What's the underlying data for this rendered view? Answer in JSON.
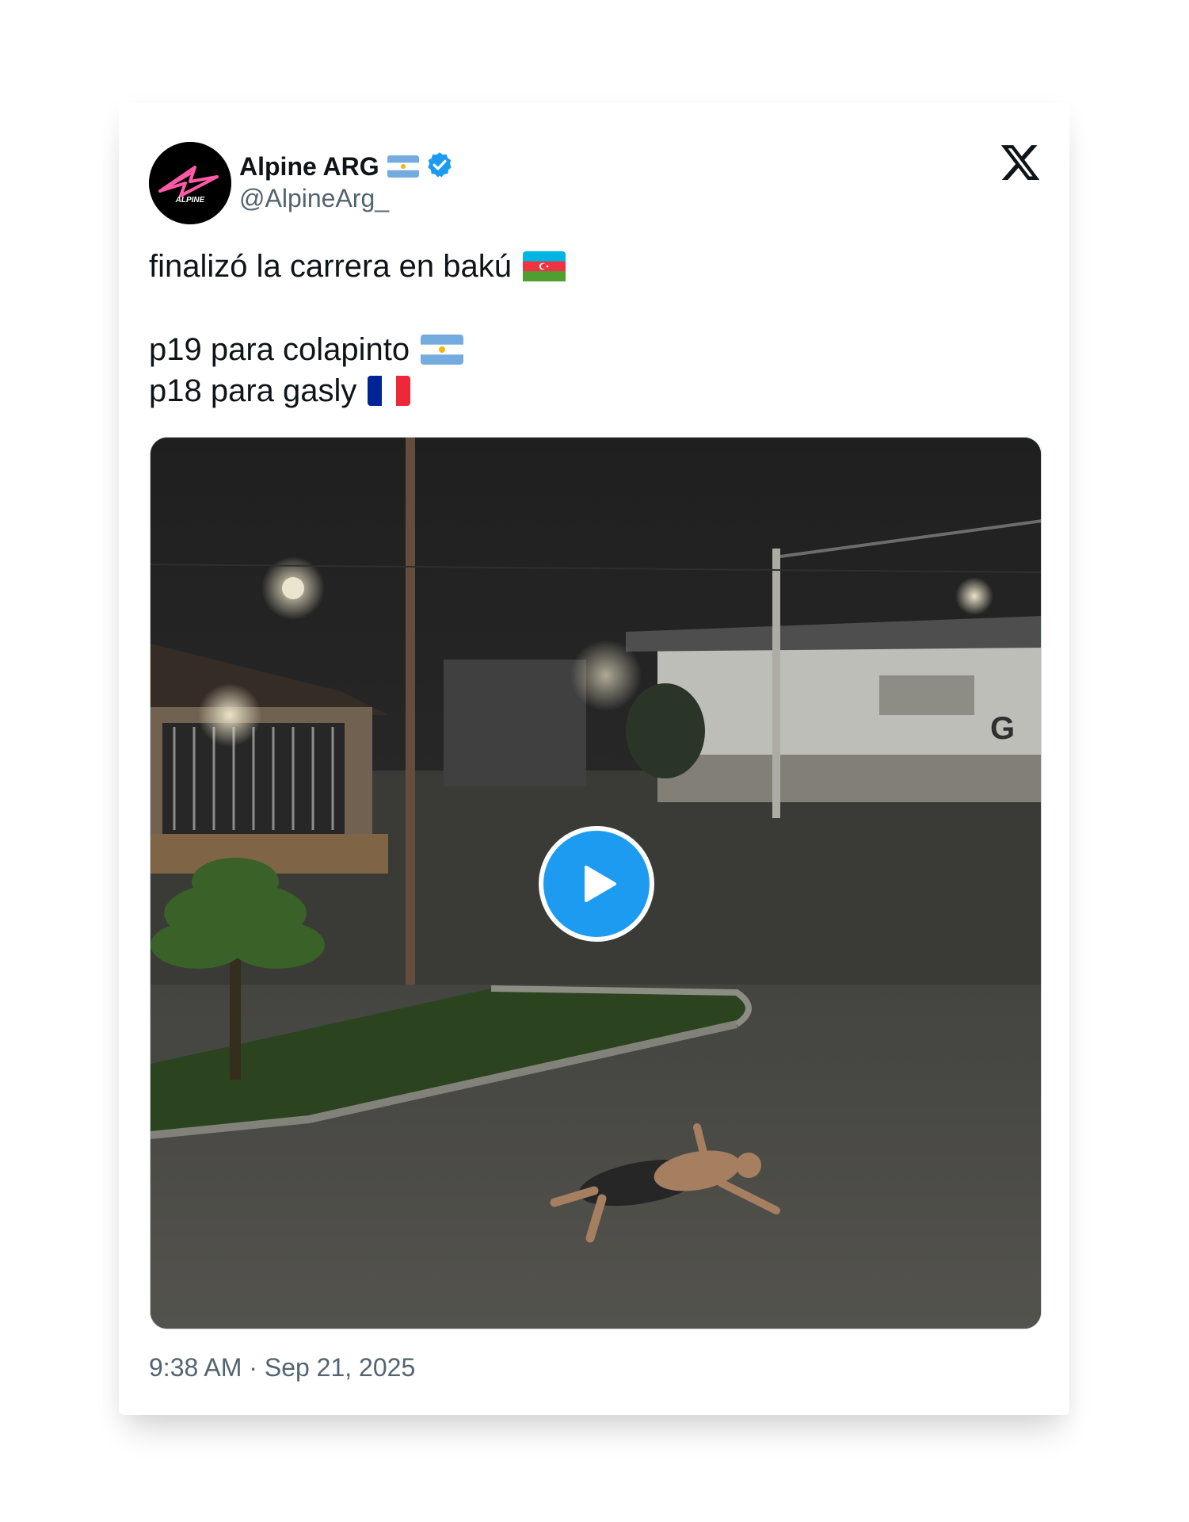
{
  "author": {
    "display_name": "Alpine ARG",
    "handle": "@AlpineArg_",
    "verified": true,
    "avatar_icon": "alpine-logo-icon",
    "avatar_logo_text": "ALPINE"
  },
  "platform": {
    "logo_icon": "x-logo-icon"
  },
  "tweet": {
    "line1": "finalizó la carrera en bakú",
    "line2": "p19 para colapinto",
    "line3": "p18 para gasly"
  },
  "media": {
    "type": "video",
    "play_icon": "play-icon",
    "sign_text": "G"
  },
  "timestamp": "9:38 AM · Sep 21, 2025",
  "colors": {
    "accent": "#1d9bf0",
    "text": "#0f1419",
    "secondary_text": "#536471",
    "alpine_pink": "#ff5aa8"
  }
}
